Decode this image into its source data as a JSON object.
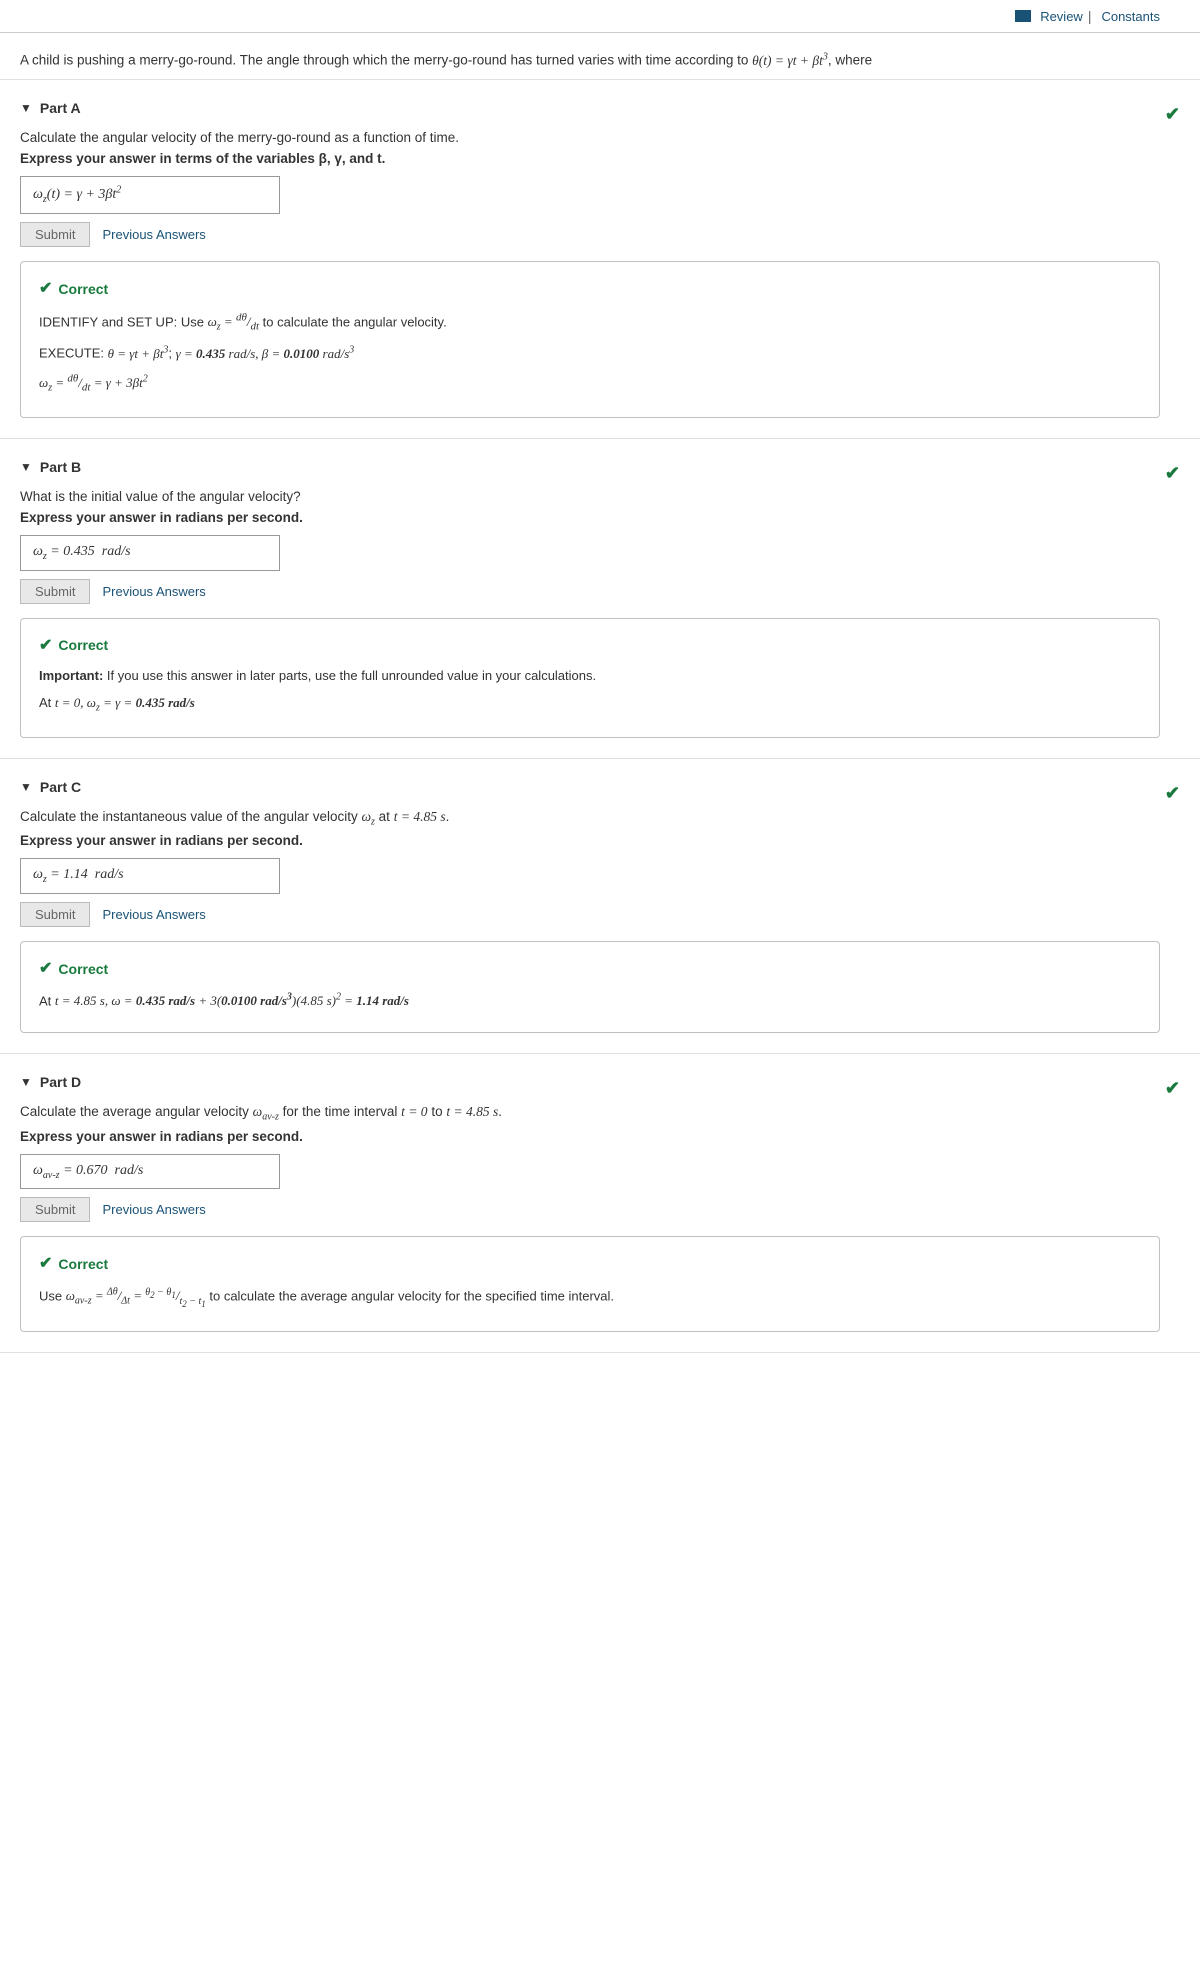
{
  "topbar": {
    "review_label": "Review",
    "constants_label": "Constants",
    "separator": "|"
  },
  "problem": {
    "statement": "A child is pushing a merry-go-round. The angle through which the merry-go-round has turned varies with time according to θ(t) = γt + βt³, where"
  },
  "parts": [
    {
      "id": "A",
      "label": "Part A",
      "question": "Calculate the angular velocity of the merry-go-round as a function of time.",
      "express": "Express your answer in terms of the variables β, γ, and t.",
      "answer_display": "ωz(t) = γ + 3βt²",
      "submit_label": "Submit",
      "prev_answers_label": "Previous Answers",
      "correct": true,
      "solution_lines": [
        "IDENTIFY and SET UP: Use ωz = dθ/dt to calculate the angular velocity.",
        "EXECUTE: θ = γt + βt³; γ = 0.435 rad/s, β = 0.0100 rad/s³",
        "ωz = dθ/dt = γ + 3βt²"
      ]
    },
    {
      "id": "B",
      "label": "Part B",
      "question": "What is the initial value of the angular velocity?",
      "express": "Express your answer in radians per second.",
      "answer_display": "ωz = 0.435  rad/s",
      "submit_label": "Submit",
      "prev_answers_label": "Previous Answers",
      "correct": true,
      "important": true,
      "important_note": "If you use this answer in later parts, use the full unrounded value in your calculations.",
      "solution_lines": [
        "At t = 0, ωz = γ = 0.435 rad/s"
      ]
    },
    {
      "id": "C",
      "label": "Part C",
      "question": "Calculate the instantaneous value of the angular velocity ωz at t = 4.85 s.",
      "express": "Express your answer in radians per second.",
      "answer_display": "ωz = 1.14  rad/s",
      "submit_label": "Submit",
      "prev_answers_label": "Previous Answers",
      "correct": true,
      "solution_lines": [
        "At t = 4.85 s, ω = 0.435 rad/s + 3(0.0100 rad/s³)(4.85 s)² = 1.14 rad/s"
      ]
    },
    {
      "id": "D",
      "label": "Part D",
      "question": "Calculate the average angular velocity ωav-z for the time interval t = 0 to t = 4.85 s.",
      "express": "Express your answer in radians per second.",
      "answer_display": "ωav-z = 0.670  rad/s",
      "submit_label": "Submit",
      "prev_answers_label": "Previous Answers",
      "correct": true,
      "solution_lines": [
        "Use ωav-z = Δθ/Δt = (θ₂ − θ₁)/(t₂ − t₁) to calculate the average angular velocity for the specified time interval."
      ]
    }
  ]
}
